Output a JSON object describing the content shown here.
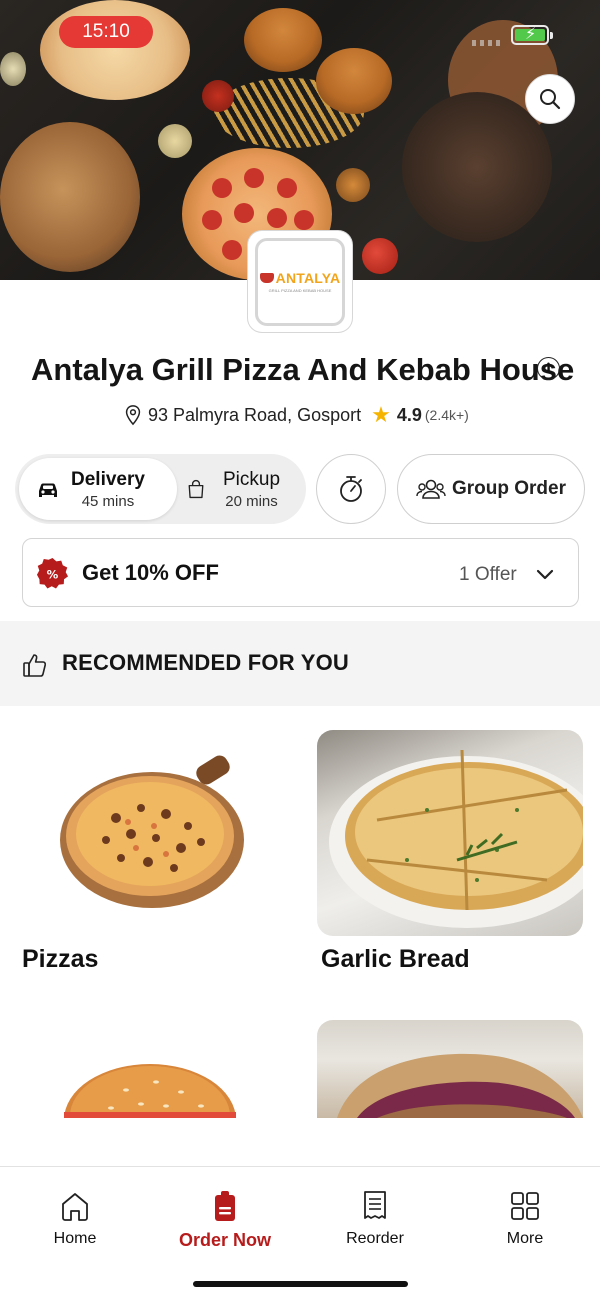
{
  "status_bar": {
    "time": "15:10"
  },
  "restaurant": {
    "name": "Antalya Grill Pizza And Kebab House",
    "logo_text": "ANTALYA",
    "logo_subtext": "GRILL PIZZA AND KEBAB HOUSE",
    "address": "93 Palmyra Road, Gosport",
    "rating": "4.9",
    "rating_count": "(2.4k+)"
  },
  "order_mode": {
    "delivery": {
      "label": "Delivery",
      "time": "45 mins",
      "selected": true
    },
    "pickup": {
      "label": "Pickup",
      "time": "20 mins",
      "selected": false
    },
    "group_order_label": "Group Order"
  },
  "offer": {
    "text": "Get 10% OFF",
    "count": "1 Offer"
  },
  "recommended": {
    "heading": "RECOMMENDED FOR YOU",
    "items": [
      {
        "label": "Pizzas"
      },
      {
        "label": "Garlic Bread"
      },
      {
        "label": ""
      },
      {
        "label": ""
      }
    ]
  },
  "tabbar": {
    "tabs": [
      {
        "label": "Home",
        "icon": "home-icon",
        "active": false
      },
      {
        "label": "Order Now",
        "icon": "order-bag-icon",
        "active": true
      },
      {
        "label": "Reorder",
        "icon": "receipt-icon",
        "active": false
      },
      {
        "label": "More",
        "icon": "grid-icon",
        "active": false
      }
    ]
  },
  "colors": {
    "accent": "#b71c1c",
    "star": "#f5b400",
    "time_pill": "#e53935",
    "battery": "#52c94a"
  }
}
